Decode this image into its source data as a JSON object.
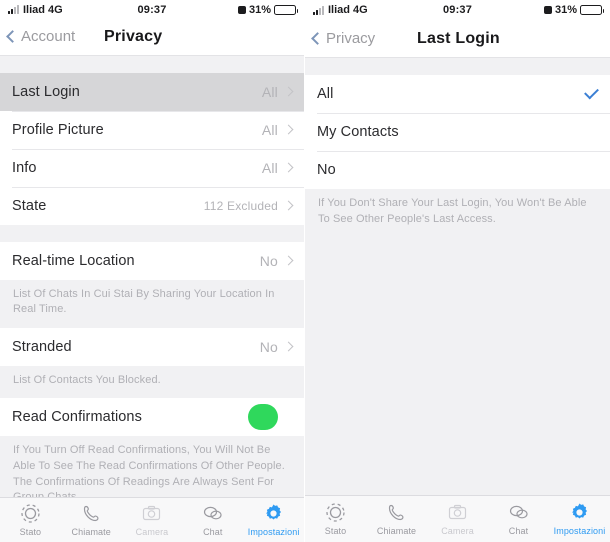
{
  "status_bar": {
    "carrier": "Iliad 4G",
    "time": "09:37",
    "battery_percent": "31%",
    "signal_icon": "signal-bars-icon",
    "alarm_icon": "alarm-icon",
    "battery_icon": "battery-icon"
  },
  "colors": {
    "accent_blue": "#2f9bf2",
    "check_blue": "#3b7fd4",
    "toggle_green": "#2fd85c",
    "page_bg": "#f1f1f3",
    "row_bg": "#ffffff",
    "selected_row_bg": "#d6d6d8",
    "muted_text": "#b0b0b5"
  },
  "left_screen": {
    "nav": {
      "back_label": "Account",
      "back_icon": "chevron-left-icon",
      "title": "Privacy"
    },
    "group_one": [
      {
        "label": "Last Login",
        "value": "All",
        "selected": true,
        "chevron": "chevron-right-icon"
      },
      {
        "label": "Profile Picture",
        "value": "All",
        "selected": false,
        "chevron": "chevron-right-icon"
      },
      {
        "label": "Info",
        "value": "All",
        "selected": false,
        "chevron": "chevron-right-icon"
      },
      {
        "label": "State",
        "value": "112 Excluded",
        "selected": false,
        "chevron": "chevron-right-icon"
      }
    ],
    "location_row": {
      "label": "Real-time Location",
      "value": "No",
      "chevron": "chevron-right-icon"
    },
    "location_footer": "List Of Chats In Cui Stai By Sharing Your Location In Real Time.",
    "blocked_row": {
      "label": "Stranded",
      "value": "No",
      "chevron": "chevron-right-icon"
    },
    "blocked_footer": "List Of Contacts You Blocked.",
    "read_row": {
      "label": "Read Confirmations",
      "toggle_on": true
    },
    "read_footer": "If You Turn Off Read Confirmations, You Will Not Be Able To See The Read Confirmations Of Other People. The Confirmations Of Readings Are Always Sent For Group Chats."
  },
  "right_screen": {
    "nav": {
      "back_label": "Privacy",
      "back_icon": "chevron-left-icon",
      "title": "Last Login"
    },
    "options": [
      {
        "label": "All",
        "checked": true,
        "check_icon": "checkmark-icon"
      },
      {
        "label": "My Contacts",
        "checked": false,
        "check_icon": "checkmark-icon"
      },
      {
        "label": "No",
        "checked": false,
        "check_icon": "checkmark-icon"
      }
    ],
    "footer": "If You Don't Share Your Last Login, You Won't Be Able To See Other People's Last Access."
  },
  "tab_bar": {
    "items": [
      {
        "label": "Stato",
        "icon": "status-rings-icon",
        "state": "normal"
      },
      {
        "label": "Chiamate",
        "icon": "phone-icon",
        "state": "normal"
      },
      {
        "label": "Camera",
        "icon": "camera-icon",
        "state": "dim"
      },
      {
        "label": "Chat",
        "icon": "chat-bubbles-icon",
        "state": "normal"
      },
      {
        "label": "Impostazioni",
        "icon": "gear-icon",
        "state": "active"
      }
    ]
  }
}
